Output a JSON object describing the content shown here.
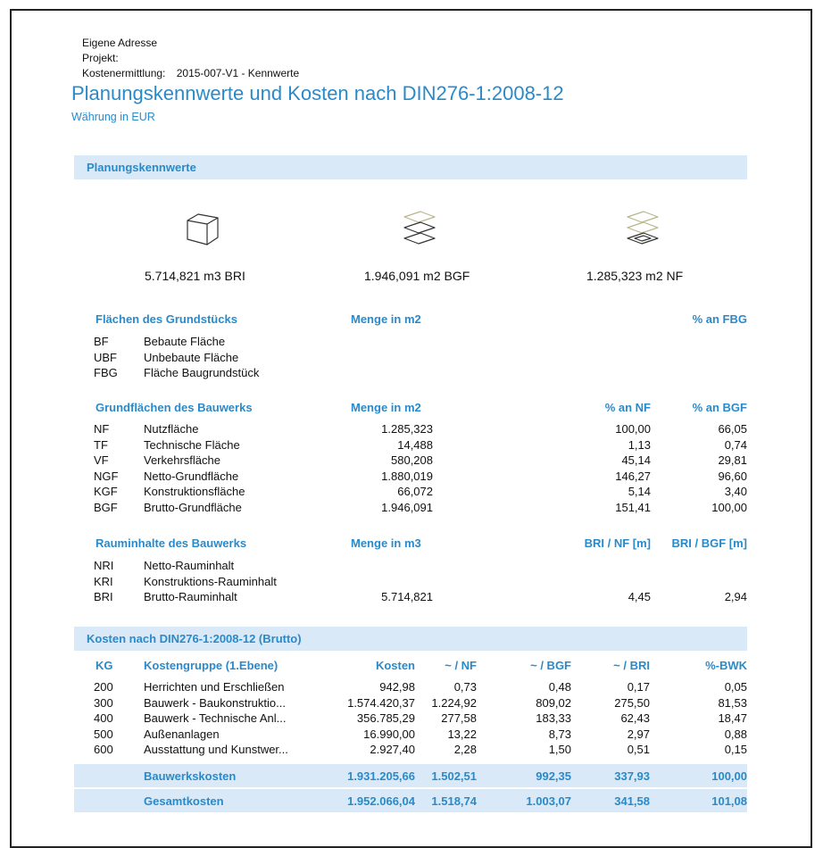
{
  "header": {
    "address": "Eigene Adresse",
    "project": "Projekt:",
    "estimation_label": "Kostenermittlung:",
    "estimation_value": "2015-007-V1 - Kennwerte"
  },
  "title": "Planungskennwerte und Kosten nach DIN276-1:2008-12",
  "subtitle": "Währung in EUR",
  "planning": {
    "heading": "Planungskennwerte",
    "kpis": [
      {
        "icon": "cube-icon",
        "text": "5.714,821 m3 BRI"
      },
      {
        "icon": "stacked-floors-icon",
        "text": "1.946,091 m2 BGF"
      },
      {
        "icon": "stacked-floors-highlight-icon",
        "text": "1.285,323 m2 NF"
      }
    ]
  },
  "site_areas": {
    "headers": [
      "Flächen des Grundstücks",
      "Menge in m2",
      "% an FBG"
    ],
    "rows": [
      {
        "code": "BF",
        "name": "Bebaute Fläche"
      },
      {
        "code": "UBF",
        "name": "Unbebaute Fläche"
      },
      {
        "code": "FBG",
        "name": "Fläche Baugrundstück"
      }
    ]
  },
  "floor_areas": {
    "headers": [
      "Grundflächen des Bauwerks",
      "Menge in m2",
      "% an NF",
      "% an BGF"
    ],
    "rows": [
      {
        "code": "NF",
        "name": "Nutzfläche",
        "qty": "1.285,323",
        "pnf": "100,00",
        "pbgf": "66,05"
      },
      {
        "code": "TF",
        "name": "Technische Fläche",
        "qty": "14,488",
        "pnf": "1,13",
        "pbgf": "0,74"
      },
      {
        "code": "VF",
        "name": "Verkehrsfläche",
        "qty": "580,208",
        "pnf": "45,14",
        "pbgf": "29,81"
      },
      {
        "code": "NGF",
        "name": "Netto-Grundfläche",
        "qty": "1.880,019",
        "pnf": "146,27",
        "pbgf": "96,60"
      },
      {
        "code": "KGF",
        "name": "Konstruktionsfläche",
        "qty": "66,072",
        "pnf": "5,14",
        "pbgf": "3,40"
      },
      {
        "code": "BGF",
        "name": "Brutto-Grundfläche",
        "qty": "1.946,091",
        "pnf": "151,41",
        "pbgf": "100,00"
      }
    ]
  },
  "volumes": {
    "headers": [
      "Rauminhalte des Bauwerks",
      "Menge in m3",
      "BRI / NF [m]",
      "BRI / BGF [m]"
    ],
    "rows": [
      {
        "code": "NRI",
        "name": "Netto-Rauminhalt",
        "qty": "",
        "a": "",
        "b": ""
      },
      {
        "code": "KRI",
        "name": "Konstruktions-Rauminhalt",
        "qty": "",
        "a": "",
        "b": ""
      },
      {
        "code": "BRI",
        "name": "Brutto-Rauminhalt",
        "qty": "5.714,821",
        "a": "4,45",
        "b": "2,94"
      }
    ]
  },
  "costs": {
    "heading": "Kosten nach DIN276-1:2008-12 (Brutto)",
    "headers": [
      "KG",
      "Kostengruppe (1.Ebene)",
      "Kosten",
      "~ / NF",
      "~ / BGF",
      "~ / BRI",
      "%-BWK"
    ],
    "rows": [
      {
        "kg": "200",
        "name": "Herrichten und Erschließen",
        "cost": "942,98",
        "nf": "0,73",
        "bgf": "0,48",
        "bri": "0,17",
        "bwk": "0,05"
      },
      {
        "kg": "300",
        "name": "Bauwerk - Baukonstruktio...",
        "cost": "1.574.420,37",
        "nf": "1.224,92",
        "bgf": "809,02",
        "bri": "275,50",
        "bwk": "81,53"
      },
      {
        "kg": "400",
        "name": "Bauwerk - Technische Anl...",
        "cost": "356.785,29",
        "nf": "277,58",
        "bgf": "183,33",
        "bri": "62,43",
        "bwk": "18,47"
      },
      {
        "kg": "500",
        "name": "Außenanlagen",
        "cost": "16.990,00",
        "nf": "13,22",
        "bgf": "8,73",
        "bri": "2,97",
        "bwk": "0,88"
      },
      {
        "kg": "600",
        "name": "Ausstattung und Kunstwer...",
        "cost": "2.927,40",
        "nf": "2,28",
        "bgf": "1,50",
        "bri": "0,51",
        "bwk": "0,15"
      }
    ],
    "totals": [
      {
        "name": "Bauwerkskosten",
        "cost": "1.931.205,66",
        "nf": "1.502,51",
        "bgf": "992,35",
        "bri": "337,93",
        "bwk": "100,00"
      },
      {
        "name": "Gesamtkosten",
        "cost": "1.952.066,04",
        "nf": "1.518,74",
        "bgf": "1.003,07",
        "bri": "341,58",
        "bwk": "101,08"
      }
    ]
  }
}
